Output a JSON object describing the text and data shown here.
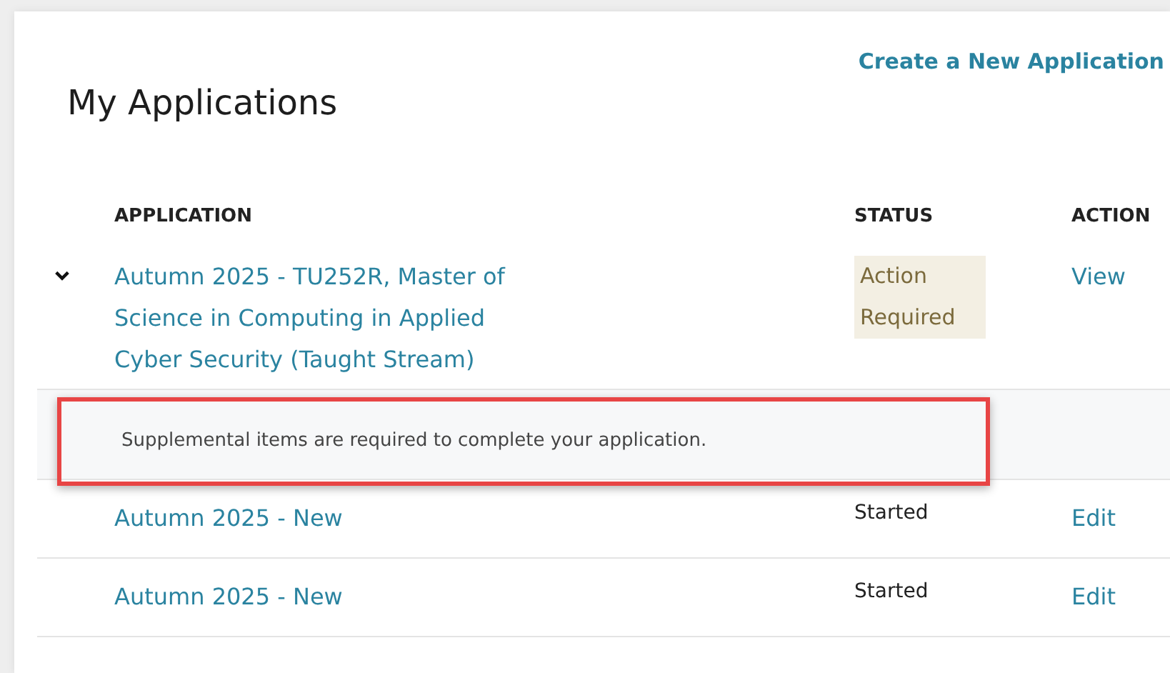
{
  "create_link": "Create a New Application",
  "title": "My Applications",
  "table": {
    "columns": [
      "APPLICATION",
      "STATUS",
      "ACTION"
    ],
    "rows": [
      {
        "name": "Autumn 2025 - TU252R, Master of Science in Computing in Applied Cyber Security (Taught Stream)",
        "status": "Action Required",
        "kind": "action_required",
        "action": "View",
        "expanded": true,
        "detail": {
          "message": "Supplemental items are required to complete your application.",
          "highlighted": true
        }
      },
      {
        "name": "Autumn 2025 - New",
        "status": "Started",
        "kind": "started",
        "action": "Edit"
      },
      {
        "name": "Autumn 2025 - New",
        "status": "Started",
        "kind": "started",
        "action": "Edit"
      }
    ]
  }
}
